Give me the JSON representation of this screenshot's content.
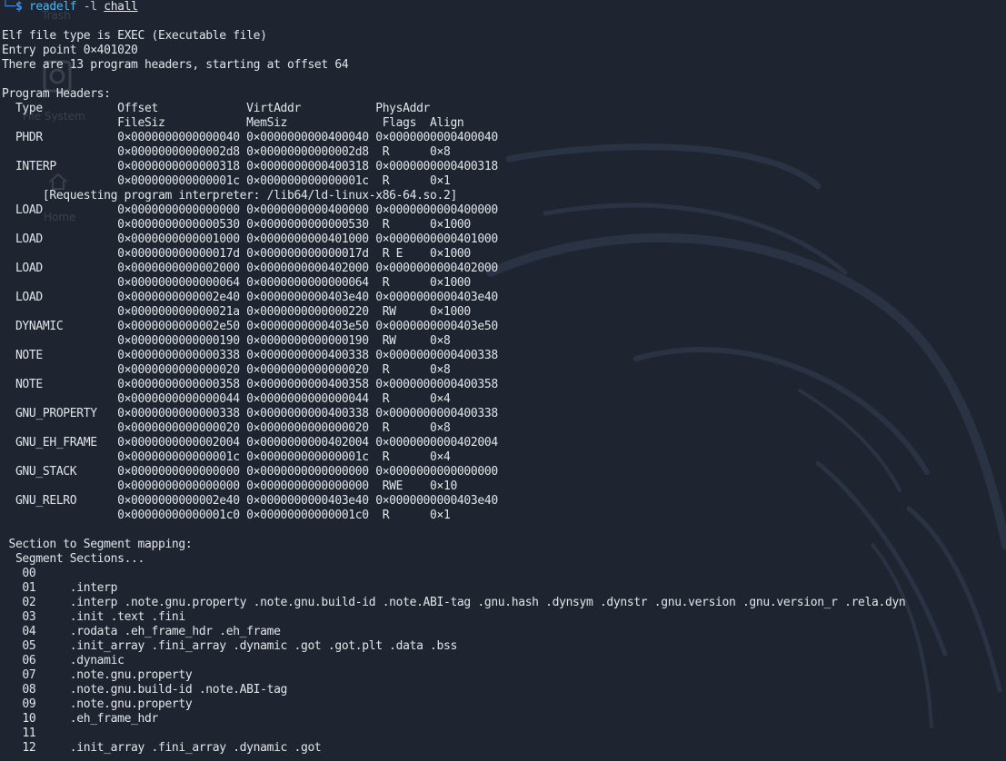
{
  "desktop": {
    "bg_color": "#1e2531",
    "icon_labels": [
      "Trash",
      "File System",
      "Home"
    ]
  },
  "prompt": {
    "corner": "└─",
    "symbol": "$",
    "command": "readelf",
    "option": "-l",
    "file": "chall"
  },
  "output": [
    "",
    "Elf file type is EXEC (Executable file)",
    "Entry point 0×401020",
    "There are 13 program headers, starting at offset 64",
    "",
    "Program Headers:",
    "  Type           Offset             VirtAddr           PhysAddr",
    "                 FileSiz            MemSiz              Flags  Align",
    "  PHDR           0×0000000000000040 0×0000000000400040 0×0000000000400040",
    "                 0×00000000000002d8 0×00000000000002d8  R      0×8",
    "  INTERP         0×0000000000000318 0×0000000000400318 0×0000000000400318",
    "                 0×000000000000001c 0×000000000000001c  R      0×1",
    "      [Requesting program interpreter: /lib64/ld-linux-x86-64.so.2]",
    "  LOAD           0×0000000000000000 0×0000000000400000 0×0000000000400000",
    "                 0×0000000000000530 0×0000000000000530  R      0×1000",
    "  LOAD           0×0000000000001000 0×0000000000401000 0×0000000000401000",
    "                 0×000000000000017d 0×000000000000017d  R E    0×1000",
    "  LOAD           0×0000000000002000 0×0000000000402000 0×0000000000402000",
    "                 0×0000000000000064 0×0000000000000064  R      0×1000",
    "  LOAD           0×0000000000002e40 0×0000000000403e40 0×0000000000403e40",
    "                 0×000000000000021a 0×0000000000000220  RW     0×1000",
    "  DYNAMIC        0×0000000000002e50 0×0000000000403e50 0×0000000000403e50",
    "                 0×0000000000000190 0×0000000000000190  RW     0×8",
    "  NOTE           0×0000000000000338 0×0000000000400338 0×0000000000400338",
    "                 0×0000000000000020 0×0000000000000020  R      0×8",
    "  NOTE           0×0000000000000358 0×0000000000400358 0×0000000000400358",
    "                 0×0000000000000044 0×0000000000000044  R      0×4",
    "  GNU_PROPERTY   0×0000000000000338 0×0000000000400338 0×0000000000400338",
    "                 0×0000000000000020 0×0000000000000020  R      0×8",
    "  GNU_EH_FRAME   0×0000000000002004 0×0000000000402004 0×0000000000402004",
    "                 0×000000000000001c 0×000000000000001c  R      0×4",
    "  GNU_STACK      0×0000000000000000 0×0000000000000000 0×0000000000000000",
    "                 0×0000000000000000 0×0000000000000000  RWE    0×10",
    "  GNU_RELRO      0×0000000000002e40 0×0000000000403e40 0×0000000000403e40",
    "                 0×00000000000001c0 0×00000000000001c0  R      0×1",
    "",
    " Section to Segment mapping:",
    "  Segment Sections...",
    "   00",
    "   01     .interp",
    "   02     .interp .note.gnu.property .note.gnu.build-id .note.ABI-tag .gnu.hash .dynsym .dynstr .gnu.version .gnu.version_r .rela.dyn",
    "   03     .init .text .fini",
    "   04     .rodata .eh_frame_hdr .eh_frame",
    "   05     .init_array .fini_array .dynamic .got .got.plt .data .bss",
    "   06     .dynamic",
    "   07     .note.gnu.property",
    "   08     .note.gnu.build-id .note.ABI-tag",
    "   09     .note.gnu.property",
    "   10     .eh_frame_hdr",
    "   11",
    "   12     .init_array .fini_array .dynamic .got"
  ]
}
